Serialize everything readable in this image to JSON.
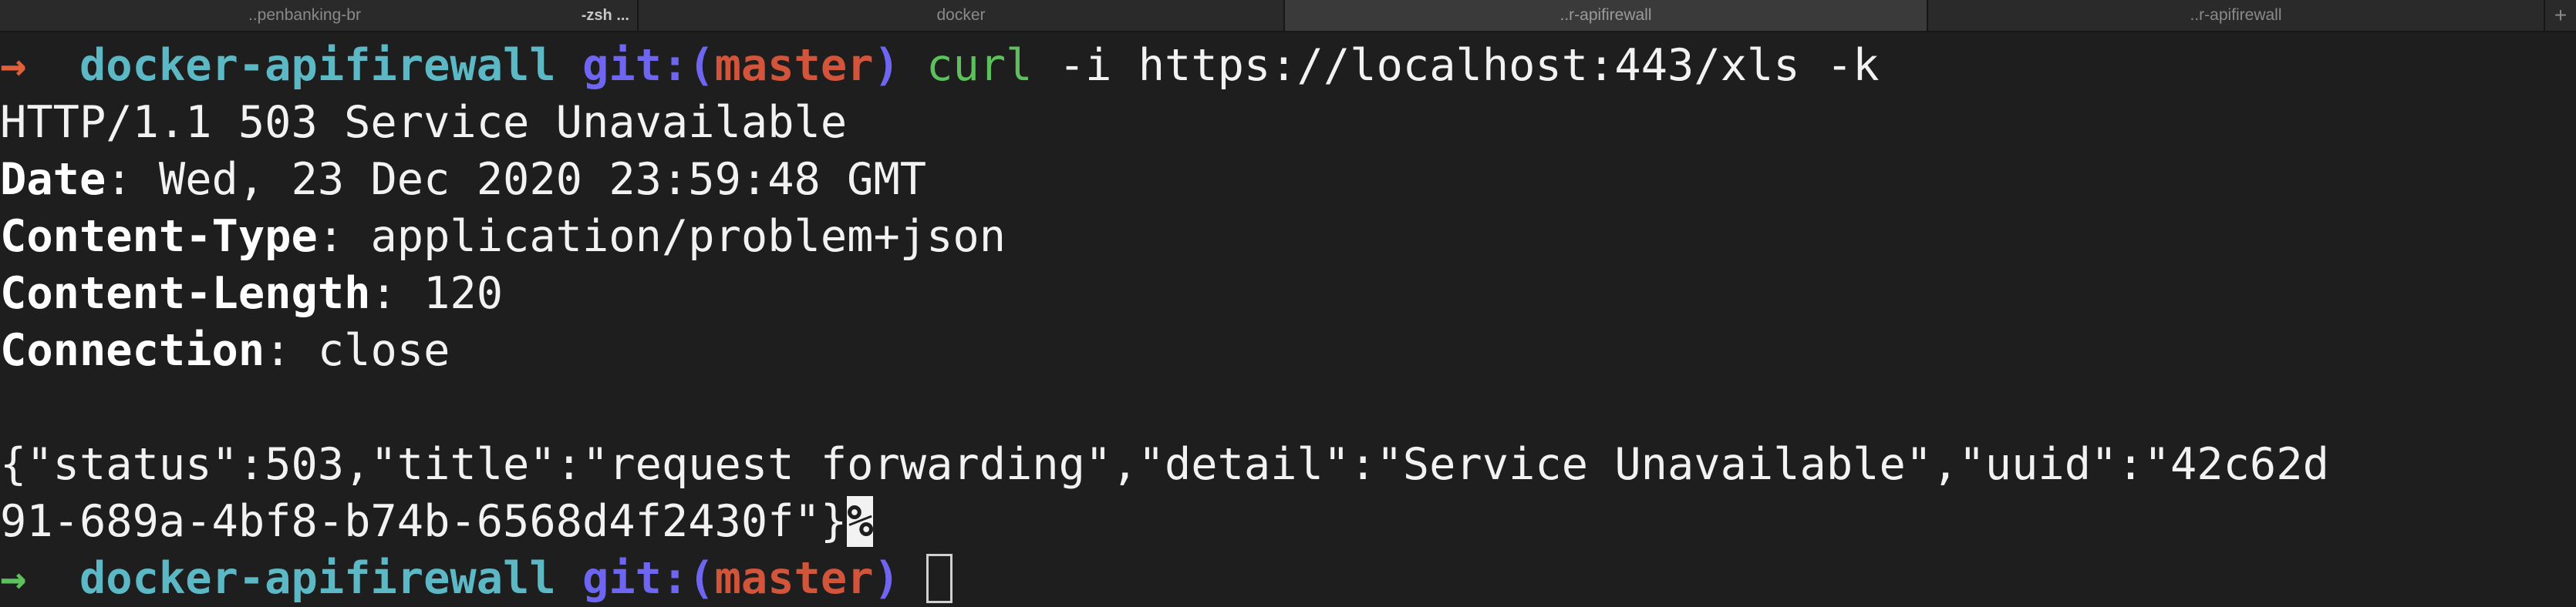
{
  "tabs": [
    {
      "label": "..penbanking-br",
      "sub": "-zsh ..."
    },
    {
      "label": "docker"
    },
    {
      "label": "..r-apifirewall"
    },
    {
      "label": "..r-apifirewall"
    }
  ],
  "tab_add_label": "+",
  "prompt": {
    "arrow": "→",
    "dir": "docker-apifirewall",
    "git_label": "git:(",
    "branch": "master",
    "git_close": ")"
  },
  "command": {
    "program": "curl",
    "args": " -i https://localhost:443/xls -k"
  },
  "response": {
    "status_line": "HTTP/1.1 503 Service Unavailable",
    "headers": [
      {
        "key": "Date",
        "value": " Wed, 23 Dec 2020 23:59:48 GMT"
      },
      {
        "key": "Content-Type",
        "value": " application/problem+json"
      },
      {
        "key": "Content-Length",
        "value": " 120"
      },
      {
        "key": "Connection",
        "value": " close"
      }
    ],
    "body_line1": "{\"status\":503,\"title\":\"request forwarding\",\"detail\":\"Service Unavailable\",\"uuid\":\"42c62d",
    "body_line2": "91-689a-4bf8-b74b-6568d4f2430f\"}",
    "no_newline_marker": "%"
  },
  "colors": {
    "background": "#1e1e1e",
    "prompt_arrow_error": "#e0603a",
    "prompt_arrow_ok": "#5cc15c",
    "dir": "#5bb8c4",
    "git": "#6e65f0",
    "branch": "#d2543a",
    "command": "#5cc15c"
  }
}
